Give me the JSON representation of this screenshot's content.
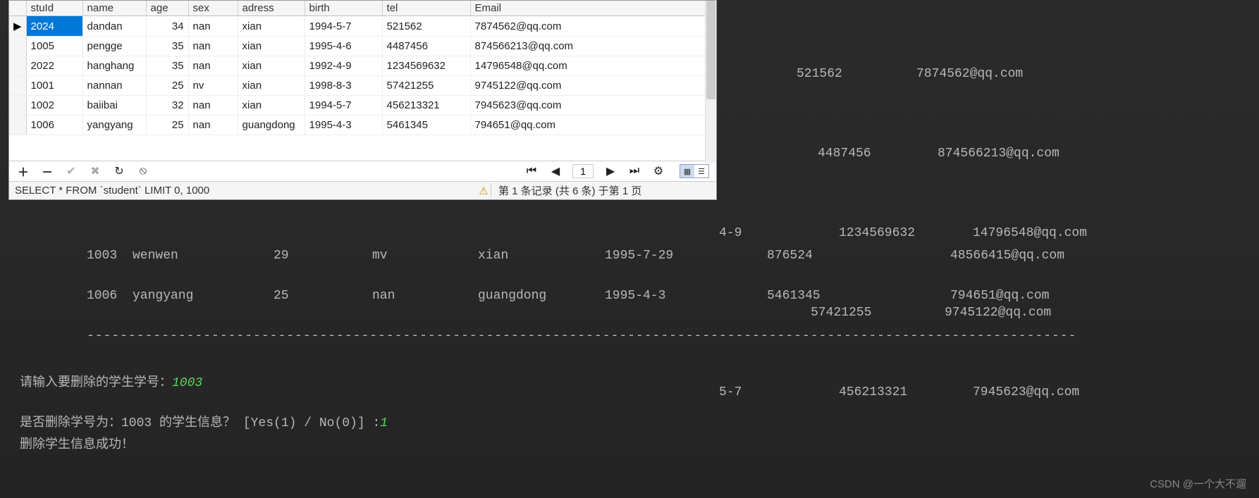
{
  "db": {
    "headers": [
      "stuId",
      "name",
      "age",
      "sex",
      "adress",
      "birth",
      "tel",
      "Email"
    ],
    "rows": [
      {
        "stuId": "2024",
        "name": "dandan",
        "age": "34",
        "sex": "nan",
        "adress": "xian",
        "birth": "1994-5-7",
        "tel": "521562",
        "email": "7874562@qq.com"
      },
      {
        "stuId": "1005",
        "name": "pengge",
        "age": "35",
        "sex": "nan",
        "adress": "xian",
        "birth": "1995-4-6",
        "tel": "4487456",
        "email": "874566213@qq.com"
      },
      {
        "stuId": "2022",
        "name": "hanghang",
        "age": "35",
        "sex": "nan",
        "adress": "xian",
        "birth": "1992-4-9",
        "tel": "1234569632",
        "email": "14796548@qq.com"
      },
      {
        "stuId": "1001",
        "name": "nannan",
        "age": "25",
        "sex": "nv",
        "adress": "xian",
        "birth": "1998-8-3",
        "tel": "57421255",
        "email": "9745122@qq.com"
      },
      {
        "stuId": "1002",
        "name": "baiibai",
        "age": "32",
        "sex": "nan",
        "adress": "xian",
        "birth": "1994-5-7",
        "tel": "456213321",
        "email": "7945623@qq.com"
      },
      {
        "stuId": "1006",
        "name": "yangyang",
        "age": "25",
        "sex": "nan",
        "adress": "guangdong",
        "birth": "1995-4-3",
        "tel": "5461345",
        "email": "794651@qq.com"
      }
    ],
    "toolbar": {
      "page": "1"
    },
    "sql": "SELECT * FROM `student` LIMIT 0, 1000",
    "record_status": "第 1 条记录 (共 6 条) 于第 1 页"
  },
  "terminal": {
    "rows_partial": [
      {
        "birthFrag": "4-9",
        "tel": "1234569632",
        "email": "14796548@qq.com"
      },
      {
        "birthFrag": "",
        "tel": "57421255",
        "email": "9745122@qq.com"
      },
      {
        "birthFrag": "5-7",
        "tel": "456213321",
        "email": "7945623@qq.com"
      }
    ],
    "row_top1": {
      "tel": "521562",
      "email": "7874562@qq.com"
    },
    "row_top2": {
      "tel": "4487456",
      "email": "874566213@qq.com"
    },
    "rows_full": [
      {
        "id": "1003",
        "name": "wenwen",
        "age": "29",
        "sex": "mv",
        "addr": "xian",
        "birth": "1995-7-29",
        "tel": "876524",
        "email": "48566415@qq.com"
      },
      {
        "id": "1006",
        "name": "yangyang",
        "age": "25",
        "sex": "nan",
        "addr": "guangdong",
        "birth": "1995-4-3",
        "tel": "5461345",
        "email": "794651@qq.com"
      }
    ],
    "dashes": "-----------------------------------------------------------------------------------------------------------------------",
    "prompt_label": "请输入要删除的学生学号：",
    "prompt_value": "1003",
    "confirm_prefix": "是否删除学号为：",
    "confirm_id": "1003",
    "confirm_suffix": " 的学生信息？ [Yes(1) / No(0)] :",
    "confirm_value": "1",
    "success": "删除学生信息成功！"
  },
  "watermark": "CSDN @一个大不遛"
}
